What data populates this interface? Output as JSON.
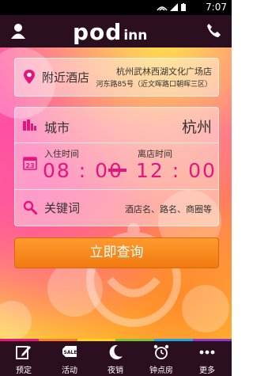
{
  "status_bar": {
    "time": "7:07"
  },
  "header": {
    "logo_main": "pod",
    "logo_sub": "inn",
    "icons": [
      "user-icon",
      "phone-icon"
    ]
  },
  "nearby": {
    "title": "附近酒店",
    "hotel_name": "杭州武林西湖文化广场店",
    "address": "河东路85号（近文晖路口朝晖三区）"
  },
  "search": {
    "city_label": "城市",
    "city_value": "杭州",
    "checkin_label": "入住时间",
    "checkin_time": "08 : 00",
    "checkout_label": "离店时间",
    "checkout_time": "12 : 00",
    "keyword_label": "关键词",
    "keyword_placeholder": "酒店名、路名、商圈等"
  },
  "query_button": "立即查询",
  "bottom_nav": [
    {
      "label": "预定",
      "icon": "edit-icon"
    },
    {
      "label": "活动",
      "icon": "sale-tag-icon",
      "badge": "SALE"
    },
    {
      "label": "夜销",
      "icon": "moon-icon"
    },
    {
      "label": "钟点房",
      "icon": "alarm-clock-icon"
    },
    {
      "label": "更多",
      "icon": "more-dots-icon"
    }
  ],
  "colors": {
    "accent": "#e6157e",
    "button": "#f07a10",
    "bar": "#2b0f1e"
  }
}
